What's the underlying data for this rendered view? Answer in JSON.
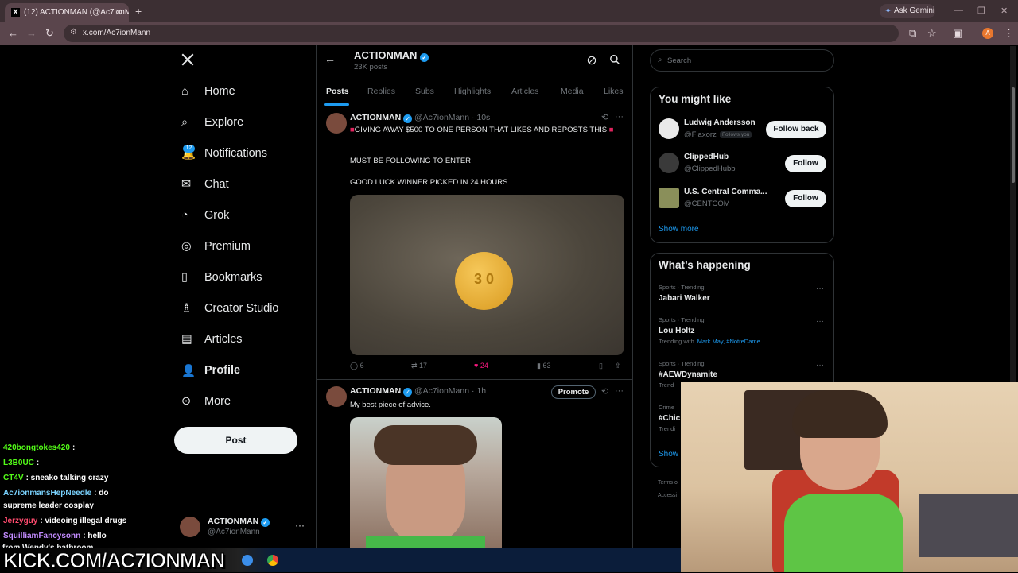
{
  "browser": {
    "tab_title": "(12) ACTIONMAN (@Ac7ionMa...",
    "new_tab": "+",
    "gemini": "Ask Gemini",
    "url": "x.com/Ac7ionMann"
  },
  "nav": {
    "items": [
      {
        "label": "Home",
        "icon": "home-icon"
      },
      {
        "label": "Explore",
        "icon": "search-icon"
      },
      {
        "label": "Notifications",
        "icon": "bell-icon"
      },
      {
        "label": "Chat",
        "icon": "mail-icon"
      },
      {
        "label": "Grok",
        "icon": "grok-icon"
      },
      {
        "label": "Premium",
        "icon": "verified-icon"
      },
      {
        "label": "Bookmarks",
        "icon": "bookmark-icon"
      },
      {
        "label": "Creator Studio",
        "icon": "flask-icon"
      },
      {
        "label": "Articles",
        "icon": "article-icon"
      },
      {
        "label": "Profile",
        "icon": "person-icon"
      },
      {
        "label": "More",
        "icon": "more-icon"
      }
    ],
    "notifications_badge": "12",
    "post_button": "Post",
    "account_name": "ACTIONMAN",
    "account_handle": "@Ac7ionMann"
  },
  "profile_header": {
    "name": "ACTIONMAN",
    "posts": "23K posts"
  },
  "tabs": [
    "Posts",
    "Replies",
    "Subs",
    "Highlights",
    "Articles",
    "Media",
    "Likes"
  ],
  "posts": [
    {
      "name": "ACTIONMAN",
      "handle": "@Ac7ionMann",
      "time": "· 10s",
      "line1": "GIVING AWAY $500 TO ONE PERSON THAT LIKES AND REPOSTS THIS",
      "line2": "MUST BE FOLLOWING TO ENTER",
      "line3": "GOOD LUCK WINNER PICKED IN 24 HOURS",
      "pill_text": "3 0",
      "replies": "6",
      "reposts": "17",
      "likes": "24",
      "views": "63"
    },
    {
      "name": "ACTIONMAN",
      "handle": "@Ac7ionMann",
      "time": "· 1h",
      "promote": "Promote",
      "text": "My best piece of advice."
    }
  ],
  "search_placeholder": "Search",
  "might_like": {
    "title": "You might like",
    "users": [
      {
        "name": "Ludwig Andersson",
        "handle": "@Flaxorz",
        "tag": "Follows you",
        "button": "Follow back"
      },
      {
        "name": "ClippedHub",
        "handle": "@ClippedHubb",
        "button": "Follow"
      },
      {
        "name": "U.S. Central Comma...",
        "handle": "@CENTCOM",
        "button": "Follow"
      }
    ],
    "show_more": "Show more"
  },
  "happening": {
    "title": "What’s happening",
    "items": [
      {
        "meta": "Sports · Trending",
        "topic": "Jabari Walker"
      },
      {
        "meta": "Sports · Trending",
        "topic": "Lou Holtz",
        "extra_prefix": "Trending with",
        "extra_links": "Mark May, #NotreDame"
      },
      {
        "meta": "Sports · Trending",
        "topic": "#AEWDynamite",
        "extra_prefix": "Trend"
      },
      {
        "meta": "Crime",
        "topic": "#Chic",
        "extra_prefix": "Trendi"
      }
    ],
    "show_more": "Show",
    "footer1": "Terms o",
    "footer2": "Accessi"
  },
  "chat": [
    {
      "user": "420bongtokes420",
      "msg": ":",
      "color": "#53fc18"
    },
    {
      "user": "L3B0UC",
      "msg": ":",
      "color": "#53fc18"
    },
    {
      "user": "CT4V",
      "msg": ": sneako talking crazy",
      "color": "#53fc18"
    },
    {
      "user": "Ac7ionmansHepNeedle",
      "msg": ": do",
      "msg2": "supreme leader cosplay",
      "color": "#7ad3ff"
    },
    {
      "user": "Jerzyguy",
      "msg": ": videoing illegal drugs",
      "color": "#ff4b6e"
    },
    {
      "user": "SquilliamFancysonn",
      "msg": ": hello",
      "color": "#c38cff"
    }
  ],
  "chat_cut": "from Wendy's bathroom",
  "kick_banner": "KICK.COM/AC7IONMAN",
  "colors": {
    "accent": "#1d9bf0",
    "like": "#f91880",
    "kick": "#53fc18"
  }
}
